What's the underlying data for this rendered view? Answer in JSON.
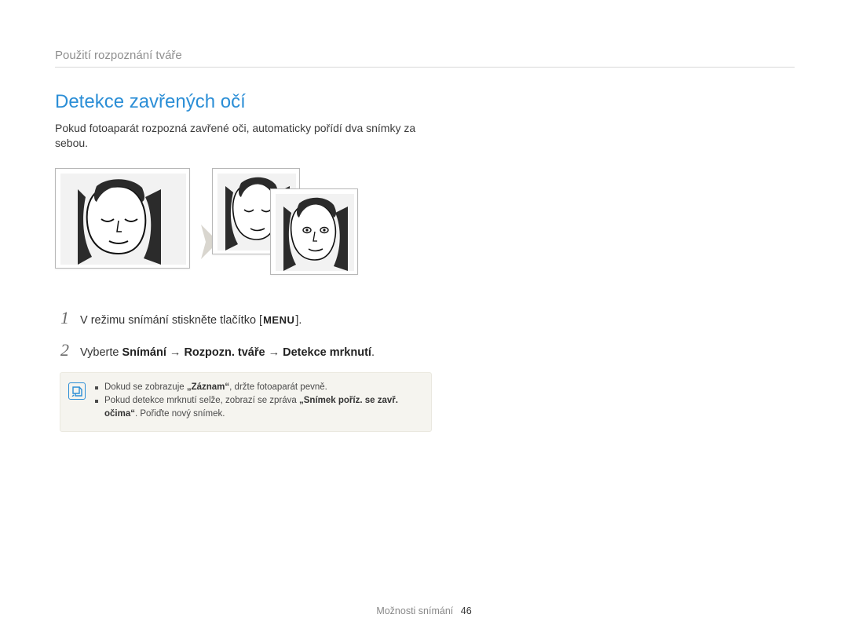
{
  "breadcrumb": "Použití rozpoznání tváře",
  "section_title": "Detekce zavřených očí",
  "intro": "Pokud fotoaparát rozpozná zavřené oči, automaticky pořídí dva snímky za sebou.",
  "menu_button_label": "MENU",
  "steps": {
    "s1": {
      "num": "1",
      "prefix": "V režimu snímání stiskněte tlačítko [",
      "suffix": "]."
    },
    "s2": {
      "num": "2",
      "prefix": "Vyberte ",
      "b1": "Snímání",
      "arrow": " → ",
      "b2": "Rozpozn. tváře",
      "b3": "Detekce mrknutí",
      "suffix": "."
    }
  },
  "notes": {
    "n1_a": "Dokud se zobrazuje ",
    "n1_b": "„Záznam“",
    "n1_c": ", držte fotoaparát pevně.",
    "n2_a": "Pokud detekce mrknutí selže, zobrazí se zpráva ",
    "n2_b": "„Snímek poříz. se zavř. očima“",
    "n2_c": ". Pořiďte nový snímek."
  },
  "footer": {
    "section": "Možnosti snímání",
    "page": "46"
  }
}
